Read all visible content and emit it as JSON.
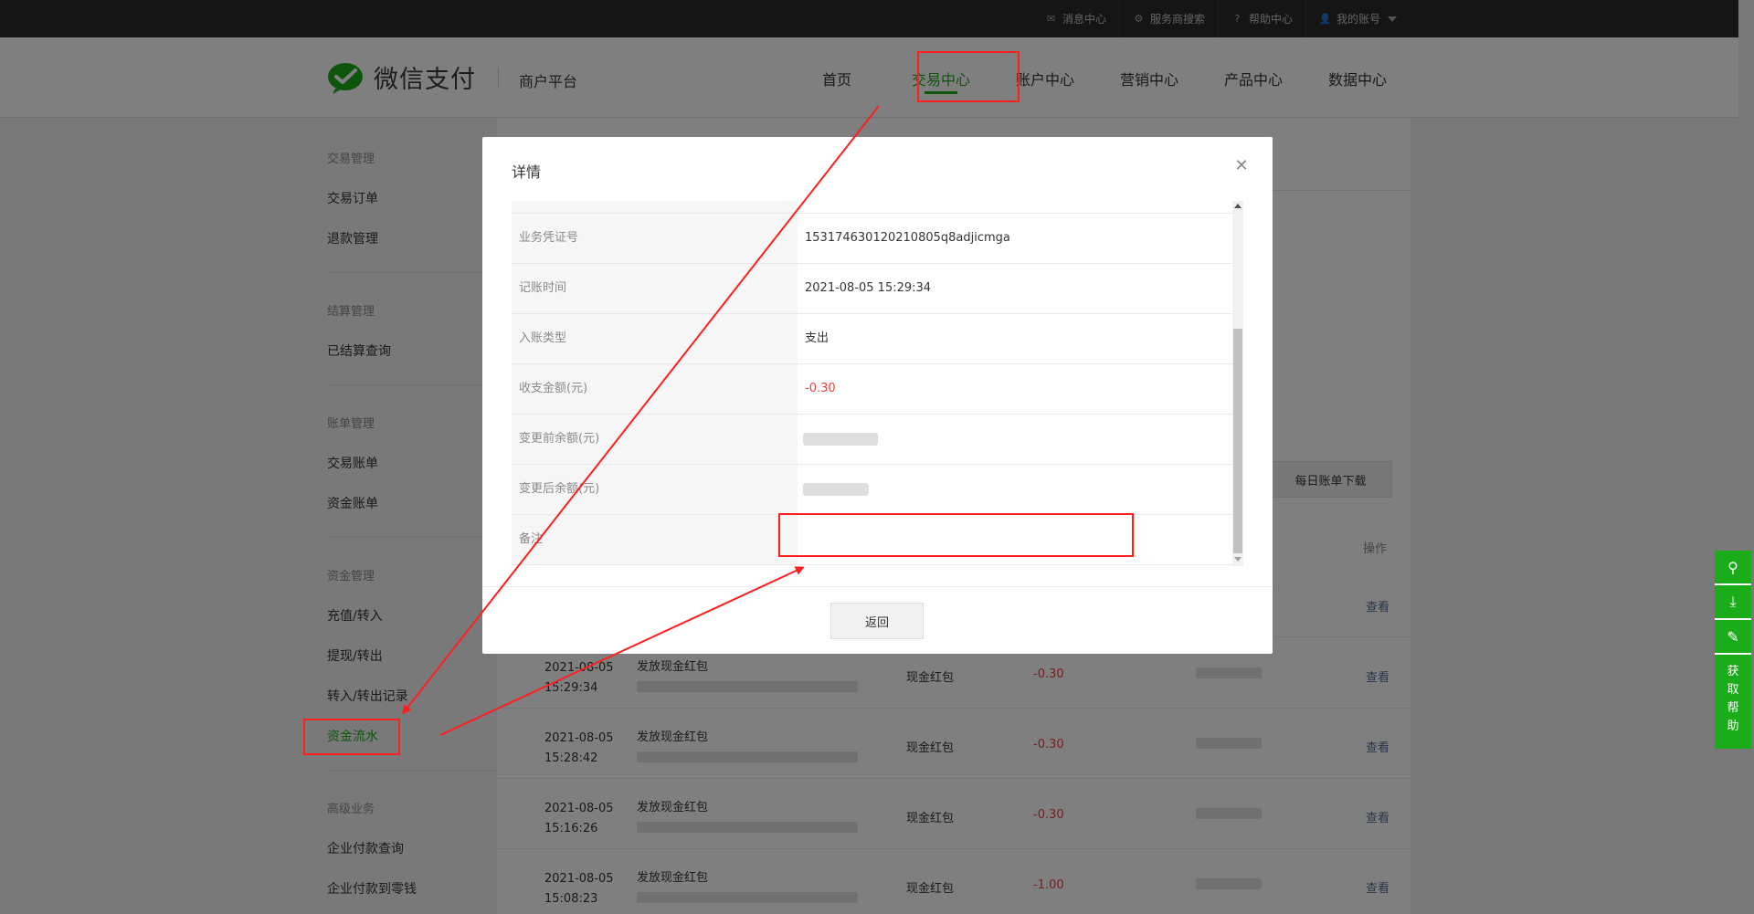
{
  "topbar": {
    "links": [
      {
        "icon": "mail-icon",
        "label": "消息中心"
      },
      {
        "icon": "gear-icon",
        "label": "服务商搜索"
      },
      {
        "icon": "help-icon",
        "label": "帮助中心"
      },
      {
        "icon": "user-icon",
        "label": "我的账号"
      }
    ]
  },
  "header": {
    "brand": "微信支付",
    "subtitle": "商户平台",
    "nav": [
      "首页",
      "交易中心",
      "账户中心",
      "营销中心",
      "产品中心",
      "数据中心"
    ],
    "active_nav": "交易中心"
  },
  "sidebar": {
    "groups": [
      {
        "title": "交易管理",
        "items": [
          "交易订单",
          "退款管理"
        ]
      },
      {
        "title": "结算管理",
        "items": [
          "已结算查询"
        ]
      },
      {
        "title": "账单管理",
        "items": [
          "交易账单",
          "资金账单"
        ]
      },
      {
        "title": "资金管理",
        "items": [
          "充值/转入",
          "提现/转出",
          "转入/转出记录",
          "资金流水"
        ]
      },
      {
        "title": "高级业务",
        "items": [
          "企业付款查询",
          "企业付款到零钱"
        ]
      }
    ],
    "active_item": "资金流水"
  },
  "main": {
    "download_button": "每日账单下载",
    "operation_header": "操作",
    "first_view": "查看",
    "rows": [
      {
        "date": "2021-08-05",
        "time": "15:29:34",
        "desc": "发放现金红包",
        "type": "现金红包",
        "amount": "-0.30",
        "op": "查看"
      },
      {
        "date": "2021-08-05",
        "time": "15:28:42",
        "desc": "发放现金红包",
        "type": "现金红包",
        "amount": "-0.30",
        "op": "查看"
      },
      {
        "date": "2021-08-05",
        "time": "15:16:26",
        "desc": "发放现金红包",
        "type": "现金红包",
        "amount": "-0.30",
        "op": "查看"
      },
      {
        "date": "2021-08-05",
        "time": "15:08:23",
        "desc": "发放现金红包",
        "type": "现金红包",
        "amount": "-1.00",
        "op": "查看"
      }
    ]
  },
  "float_bar": {
    "help_label": [
      "获",
      "取",
      "帮",
      "助"
    ]
  },
  "modal": {
    "title": "详情",
    "rows": [
      {
        "key": "业务凭证号",
        "value": "15317463012021080​5q8adjicmga"
      },
      {
        "key": "记账时间",
        "value": "2021-08-05 15:29:34"
      },
      {
        "key": "入账类型",
        "value": "支出"
      },
      {
        "key": "收支金额(元)",
        "value": "-0.30"
      },
      {
        "key": "变更前余额(元)",
        "value": ""
      },
      {
        "key": "变更后余额(元)",
        "value": ""
      },
      {
        "key": "备注",
        "value": ""
      }
    ],
    "back_button": "返回"
  },
  "colors": {
    "brand_green": "#1aad19",
    "negative_red": "#e64340",
    "link_blue": "#576b95",
    "annotation_red": "#ff1f1f"
  }
}
